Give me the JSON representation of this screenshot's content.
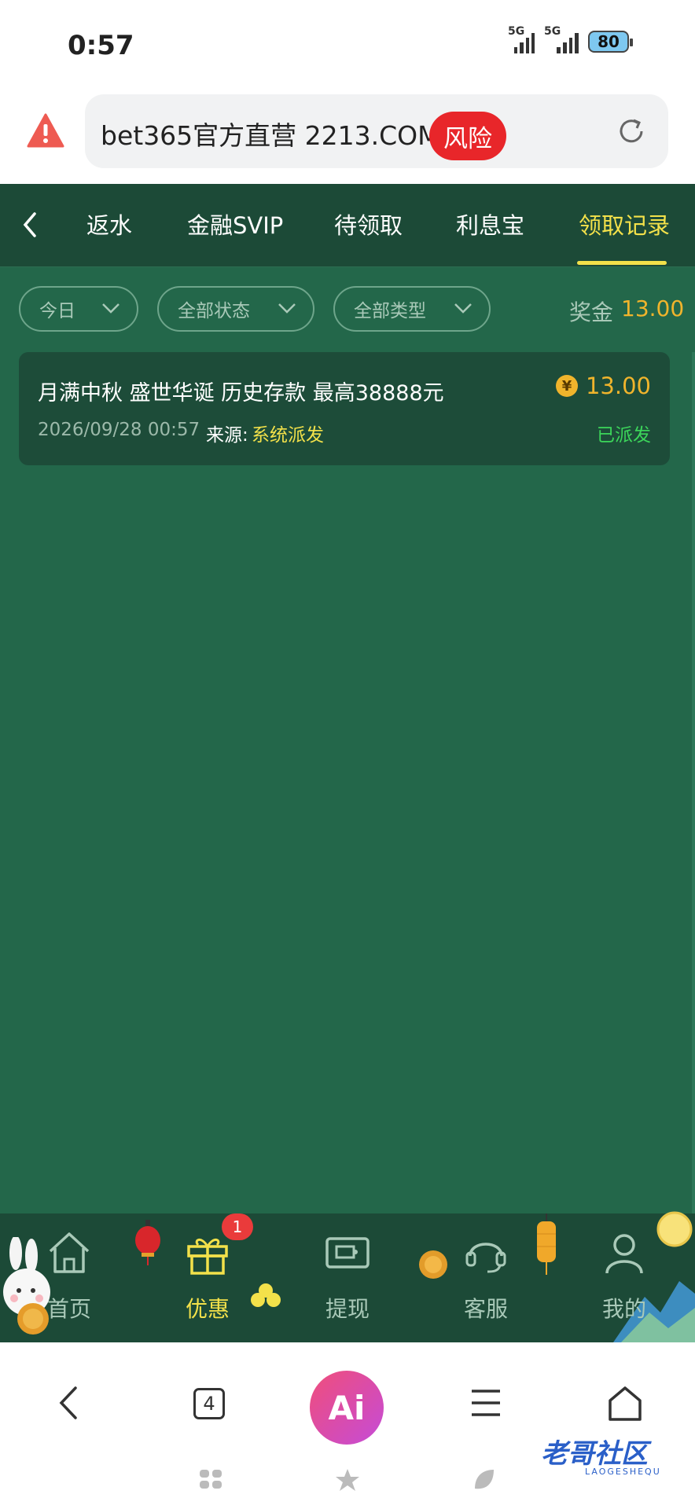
{
  "status_bar": {
    "time": "0:57",
    "net1": "5G",
    "net2": "5G",
    "battery": "80"
  },
  "url_bar": {
    "url": "bet365官方直营 2213.COM",
    "risk_badge": "风险"
  },
  "tabs": [
    {
      "label": "返水"
    },
    {
      "label": "金融SVIP"
    },
    {
      "label": "待领取"
    },
    {
      "label": "利息宝"
    },
    {
      "label": "领取记录",
      "active": true
    }
  ],
  "filters": [
    {
      "label": "今日"
    },
    {
      "label": "全部状态"
    },
    {
      "label": "全部类型"
    }
  ],
  "bonus_summary": {
    "label": "奖金",
    "value": "13.00"
  },
  "records": [
    {
      "title": "月满中秋 盛世华诞 历史存款 最高38888元",
      "currency_symbol": "¥",
      "amount": "13.00",
      "datetime": "2026/09/28 00:57",
      "source_label": "来源:",
      "source_value": "系统派发",
      "status": "已派发"
    }
  ],
  "app_nav": {
    "items": [
      {
        "label": "首页",
        "icon": "home-icon"
      },
      {
        "label": "优惠",
        "icon": "gift-icon",
        "active": true,
        "badge": "1"
      },
      {
        "label": "提现",
        "icon": "withdraw-icon"
      },
      {
        "label": "客服",
        "icon": "headset-icon"
      },
      {
        "label": "我的",
        "icon": "user-icon"
      }
    ]
  },
  "browser_bar": {
    "tab_count": "4",
    "ai_label": "Ai"
  },
  "watermark": {
    "text": "老哥社区",
    "sub": "LAOGESHEQU"
  },
  "colors": {
    "app_bg": "#23674a",
    "header_bg": "#1c4a37",
    "accent_yellow": "#f3e14a",
    "amount_gold": "#f0b42c",
    "status_green": "#3cd65a",
    "risk_red": "#e8262a"
  }
}
